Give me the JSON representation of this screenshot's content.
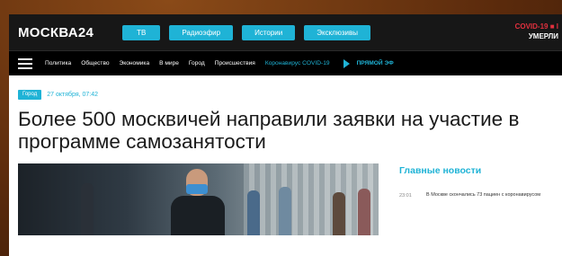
{
  "header": {
    "logo": "МОСКВА24",
    "pills": [
      "ТВ",
      "Радиоэфир",
      "Истории",
      "Эксклюзивы"
    ],
    "covid_line1": "COVID-19 ■ I",
    "covid_line2": "УМЕРЛИ"
  },
  "nav": {
    "items": [
      "Политика",
      "Общество",
      "Экономика",
      "В мире",
      "Город",
      "Происшествия"
    ],
    "covid": "Коронавирус COVID-19",
    "live": "ПРЯМОЙ ЭФ"
  },
  "article": {
    "tag": "Город",
    "date": "27 октября, 07:42",
    "headline": "Более 500 москвичей направили заявки на участие в программе самозанятости"
  },
  "sidebar": {
    "title": "Главные новости",
    "news": [
      {
        "time": "23:01",
        "text": "В Москве скончались 73 пациен с коронавирусом"
      }
    ]
  },
  "colors": {
    "accent": "#1fb3d6",
    "topbar": "#171717",
    "navbar": "#000000",
    "covid_red": "#e2303e"
  }
}
